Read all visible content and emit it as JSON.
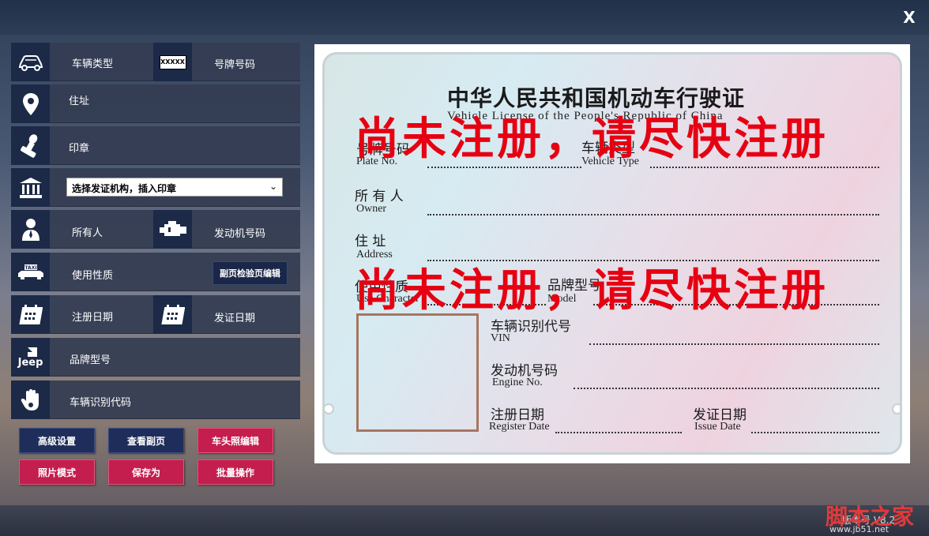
{
  "window": {
    "close_label": "X"
  },
  "form": {
    "vehicle_type": "车辆类型",
    "plate_number": "号牌号码",
    "plate_icon_text": "XXXXX",
    "address": "住址",
    "stamp": "印章",
    "issuing_select": "选择发证机构，插入印章",
    "owner": "所有人",
    "engine_number": "发动机号码",
    "use_character": "使用性质",
    "taxi_icon_text": "TAXI",
    "secondary_page_edit": "副页检验页编辑",
    "register_date": "注册日期",
    "issue_date": "发证日期",
    "brand_model": "品牌型号",
    "jeep_icon_text": "Jeep",
    "vin": "车辆识别代码"
  },
  "actions": {
    "advanced_settings": "高级设置",
    "view_secondary": "查看副页",
    "front_photo_edit": "车头照编辑",
    "photo_mode": "照片模式",
    "save_as": "保存为",
    "batch_operation": "批量操作"
  },
  "license": {
    "title": "中华人民共和国机动车行驶证",
    "subtitle": "Vehicle License of the People's Republic of China",
    "plate_no_cn": "号牌号码",
    "plate_no_en": "Plate No.",
    "vehicle_type_cn": "车辆类型",
    "vehicle_type_en": "Vehicle Type",
    "owner_cn": "所 有 人",
    "owner_en": "Owner",
    "address_cn": "住    址",
    "address_en": "Address",
    "use_character_cn": "使用性质",
    "use_character_en": "Use Character",
    "model_cn": "品牌型号",
    "model_en": "Model",
    "vin_cn": "车辆识别代号",
    "vin_en": "VIN",
    "engine_cn": "发动机号码",
    "engine_en": "Engine No.",
    "register_cn": "注册日期",
    "register_en": "Register Date",
    "issue_cn": "发证日期",
    "issue_en": "Issue Date",
    "watermark": "尚未注册，请尽快注册"
  },
  "footer": {
    "version": "版本号 V8.2",
    "site_watermark": "脚本之家",
    "site_url": "www.jb51.net"
  },
  "colors": {
    "navy_button": "#1e2d5a",
    "red_button": "#c31e4e",
    "watermark_red": "#e60012"
  }
}
